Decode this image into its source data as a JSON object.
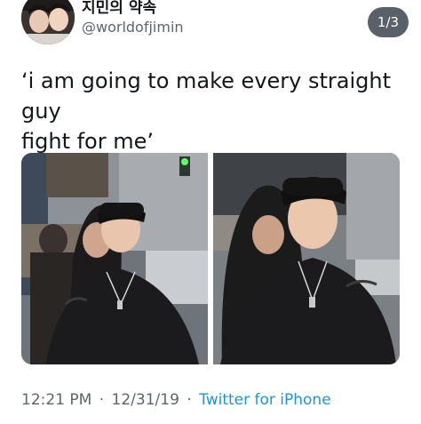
{
  "tweet": {
    "display_name": "지민의 약속",
    "handle": "@worldofjimin",
    "media_counter": "1/3",
    "text": "‘i am going to make every straight guy\nfight for me’",
    "time": "12:21 PM",
    "separator": "·",
    "date": "12/31/19",
    "source": "Twitter for iPhone"
  },
  "icons": {
    "avatar": "profile-photo-avatar"
  },
  "colors": {
    "text_primary": "#14171a",
    "text_secondary": "#5b6670",
    "link": "#1b95e0",
    "counter_bg": "#5a6068"
  }
}
